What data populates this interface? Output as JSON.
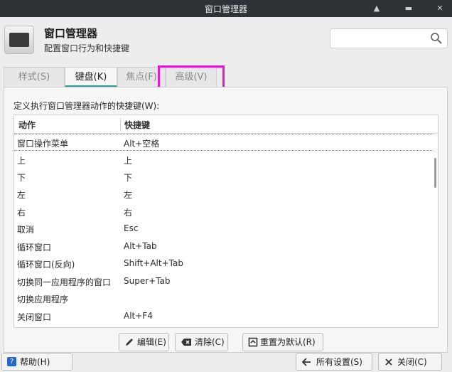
{
  "window": {
    "title": "窗口管理器"
  },
  "header": {
    "title": "窗口管理器",
    "subtitle": "配置窗口行为和快捷键",
    "search_placeholder": ""
  },
  "tabs": [
    {
      "label": "样式(S)"
    },
    {
      "label": "键盘(K)"
    },
    {
      "label": "焦点(F)"
    },
    {
      "label": "高级(V)"
    }
  ],
  "panel": {
    "label": "定义执行窗口管理器动作的快捷键(W):"
  },
  "table": {
    "headers": [
      "动作",
      "快捷键"
    ],
    "rows": [
      {
        "action": "窗口操作菜单",
        "shortcut": "Alt+空格"
      },
      {
        "action": "上",
        "shortcut": "上"
      },
      {
        "action": "下",
        "shortcut": "下"
      },
      {
        "action": "左",
        "shortcut": "左"
      },
      {
        "action": "右",
        "shortcut": "右"
      },
      {
        "action": "取消",
        "shortcut": "Esc"
      },
      {
        "action": "循环窗口",
        "shortcut": "Alt+Tab"
      },
      {
        "action": "循环窗口(反向)",
        "shortcut": "Shift+Alt+Tab"
      },
      {
        "action": "切换同一应用程序的窗口",
        "shortcut": "Super+Tab"
      },
      {
        "action": "切换应用程序",
        "shortcut": ""
      },
      {
        "action": "关闭窗口",
        "shortcut": "Alt+F4"
      }
    ]
  },
  "actions": {
    "edit": "编辑(E)",
    "clear": "清除(C)",
    "reset": "重置为默认(R)"
  },
  "footer": {
    "help": "帮助(H)",
    "all_settings": "所有设置(S)",
    "close": "关闭(C)"
  },
  "colors": {
    "accent": "#2aa198",
    "highlight": "#e41bcd",
    "titlebar": "#2f3237"
  }
}
